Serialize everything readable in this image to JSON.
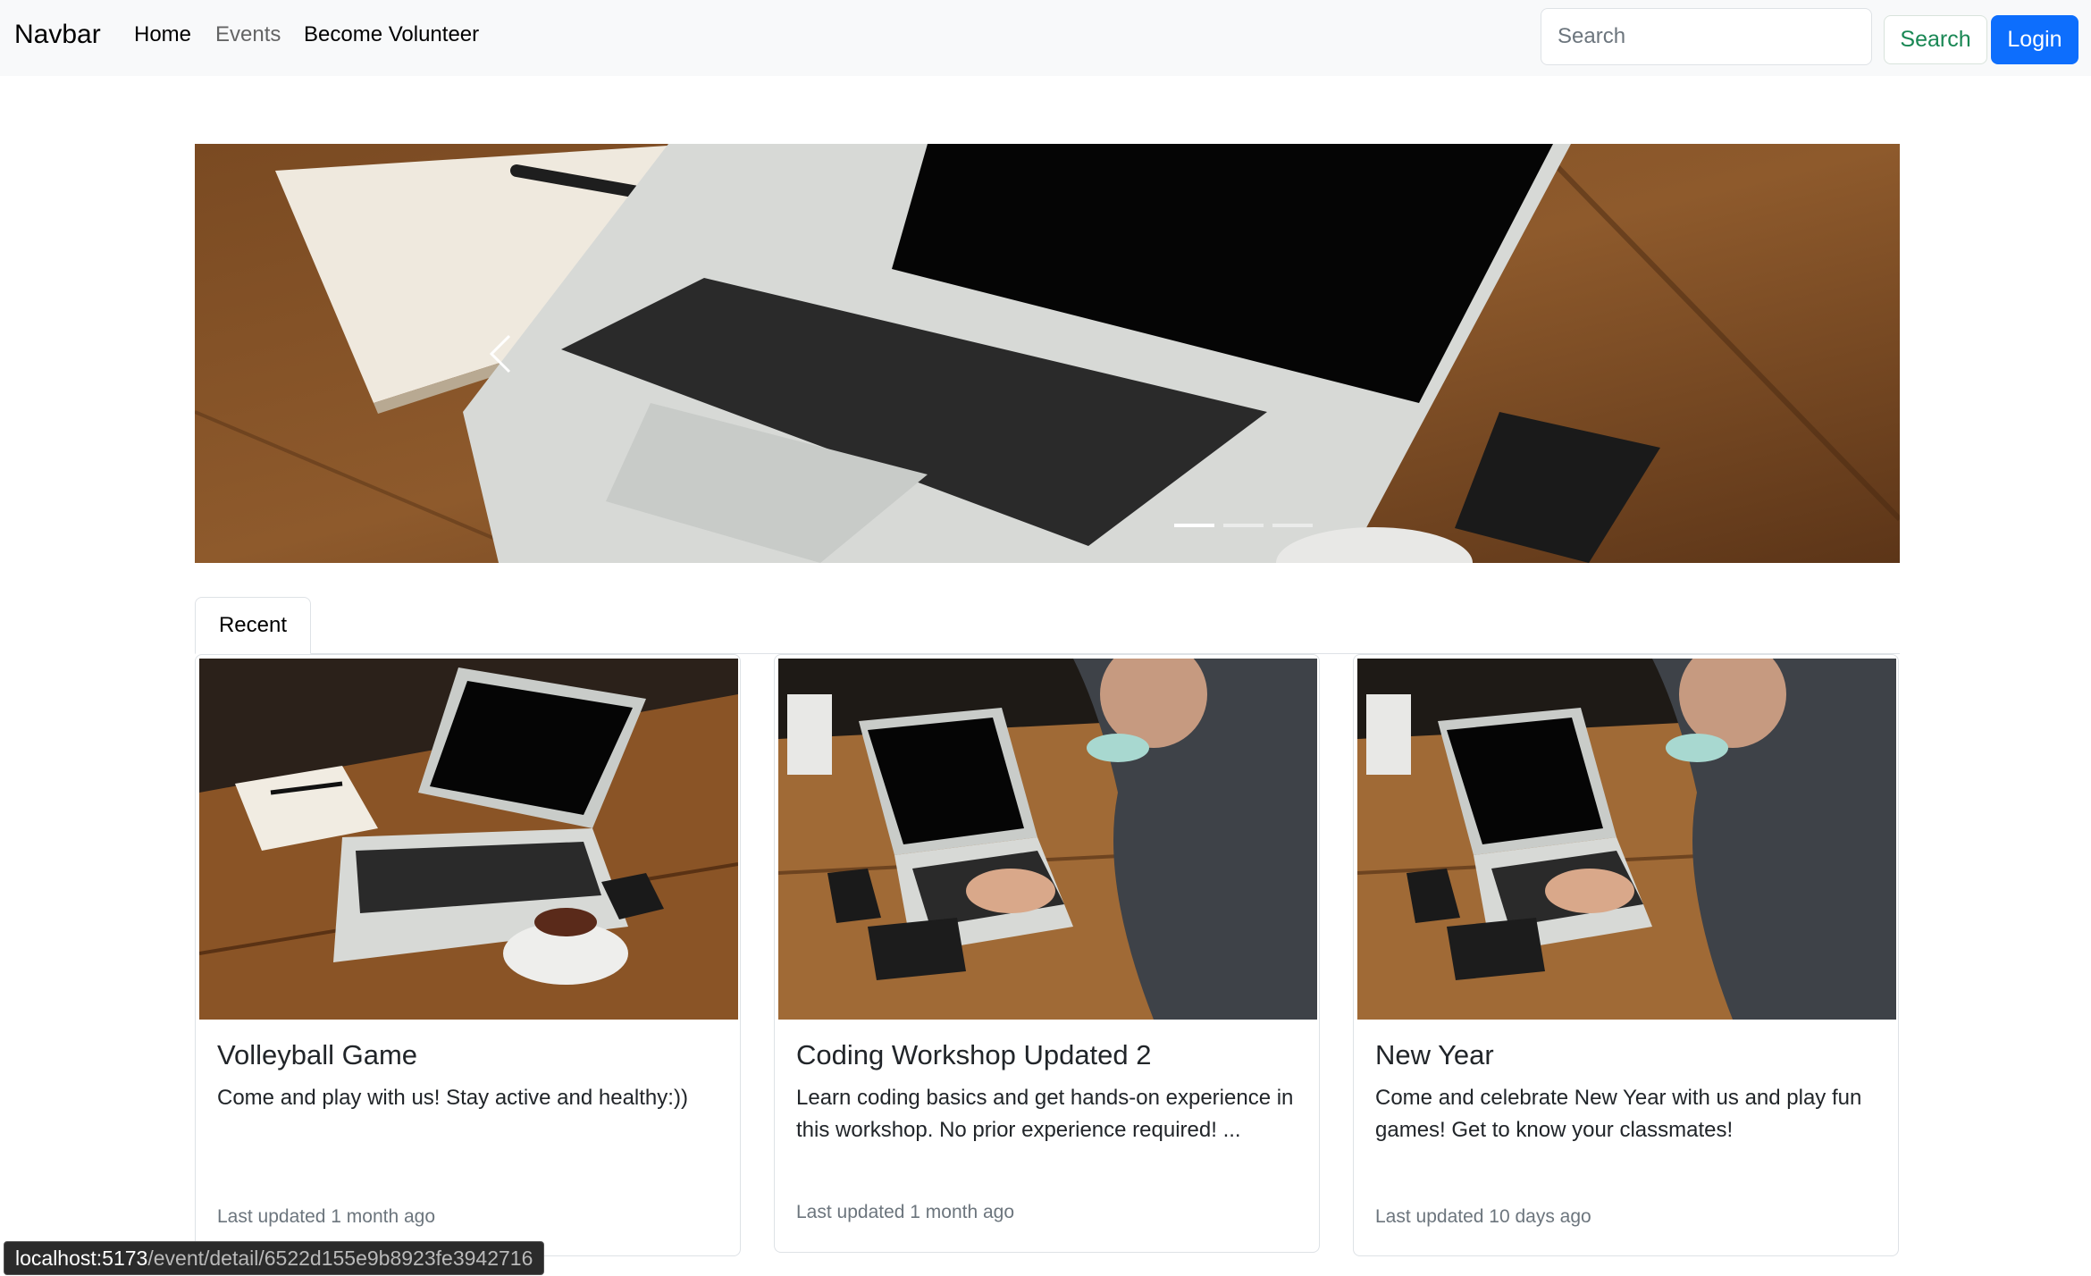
{
  "navbar": {
    "brand": "Navbar",
    "links": [
      {
        "label": "Home"
      },
      {
        "label": "Events"
      },
      {
        "label": "Become Volunteer"
      }
    ],
    "search_placeholder": "Search",
    "search_button": "Search",
    "login_button": "Login"
  },
  "carousel": {
    "slide_count": 3,
    "active_index": 0
  },
  "tabs": {
    "active": "Recent"
  },
  "cards": [
    {
      "title": "Volleyball Game",
      "description": "Come and play with us! Stay active and healthy:))",
      "updated": "Last updated 1 month ago"
    },
    {
      "title": "Coding Workshop Updated 2",
      "description": "Learn coding basics and get hands-on experience in this workshop. No prior experience required! ...",
      "updated": "Last updated 1 month ago"
    },
    {
      "title": "New Year",
      "description": "Come and celebrate New Year with us and play fun games! Get to know your classmates!",
      "updated": "Last updated 10 days ago"
    }
  ],
  "status_bar": {
    "host": "localhost:5173",
    "path": "/event/detail/6522d155e9b8923fe3942716"
  },
  "colors": {
    "navbar_bg": "#f8f9fa",
    "primary": "#0d6efd",
    "success": "#198754",
    "muted_text": "#6c757d"
  }
}
